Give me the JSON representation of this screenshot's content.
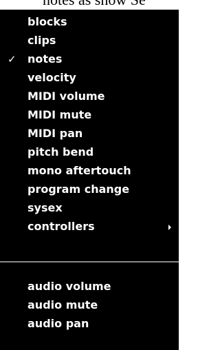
{
  "window": {
    "title_fragment": "notes as show Se"
  },
  "menu": {
    "items": [
      {
        "label": "blocks",
        "checked": false,
        "submenu": false
      },
      {
        "label": "clips",
        "checked": false,
        "submenu": false
      },
      {
        "label": "notes",
        "checked": true,
        "submenu": false,
        "check_mark": "✓"
      },
      {
        "label": "velocity",
        "checked": false,
        "submenu": false
      },
      {
        "label": "MIDI volume",
        "checked": false,
        "submenu": false
      },
      {
        "label": "MIDI mute",
        "checked": false,
        "submenu": false
      },
      {
        "label": "MIDI pan",
        "checked": false,
        "submenu": false
      },
      {
        "label": "pitch bend",
        "checked": false,
        "submenu": false
      },
      {
        "label": "mono aftertouch",
        "checked": false,
        "submenu": false
      },
      {
        "label": "program change",
        "checked": false,
        "submenu": false
      },
      {
        "label": "sysex",
        "checked": false,
        "submenu": false
      },
      {
        "label": "controllers",
        "checked": false,
        "submenu": true,
        "submenu_icon": "submenu-arrow-icon"
      }
    ],
    "audio_items": [
      {
        "label": "audio volume"
      },
      {
        "label": "audio mute"
      },
      {
        "label": "audio pan"
      }
    ]
  }
}
